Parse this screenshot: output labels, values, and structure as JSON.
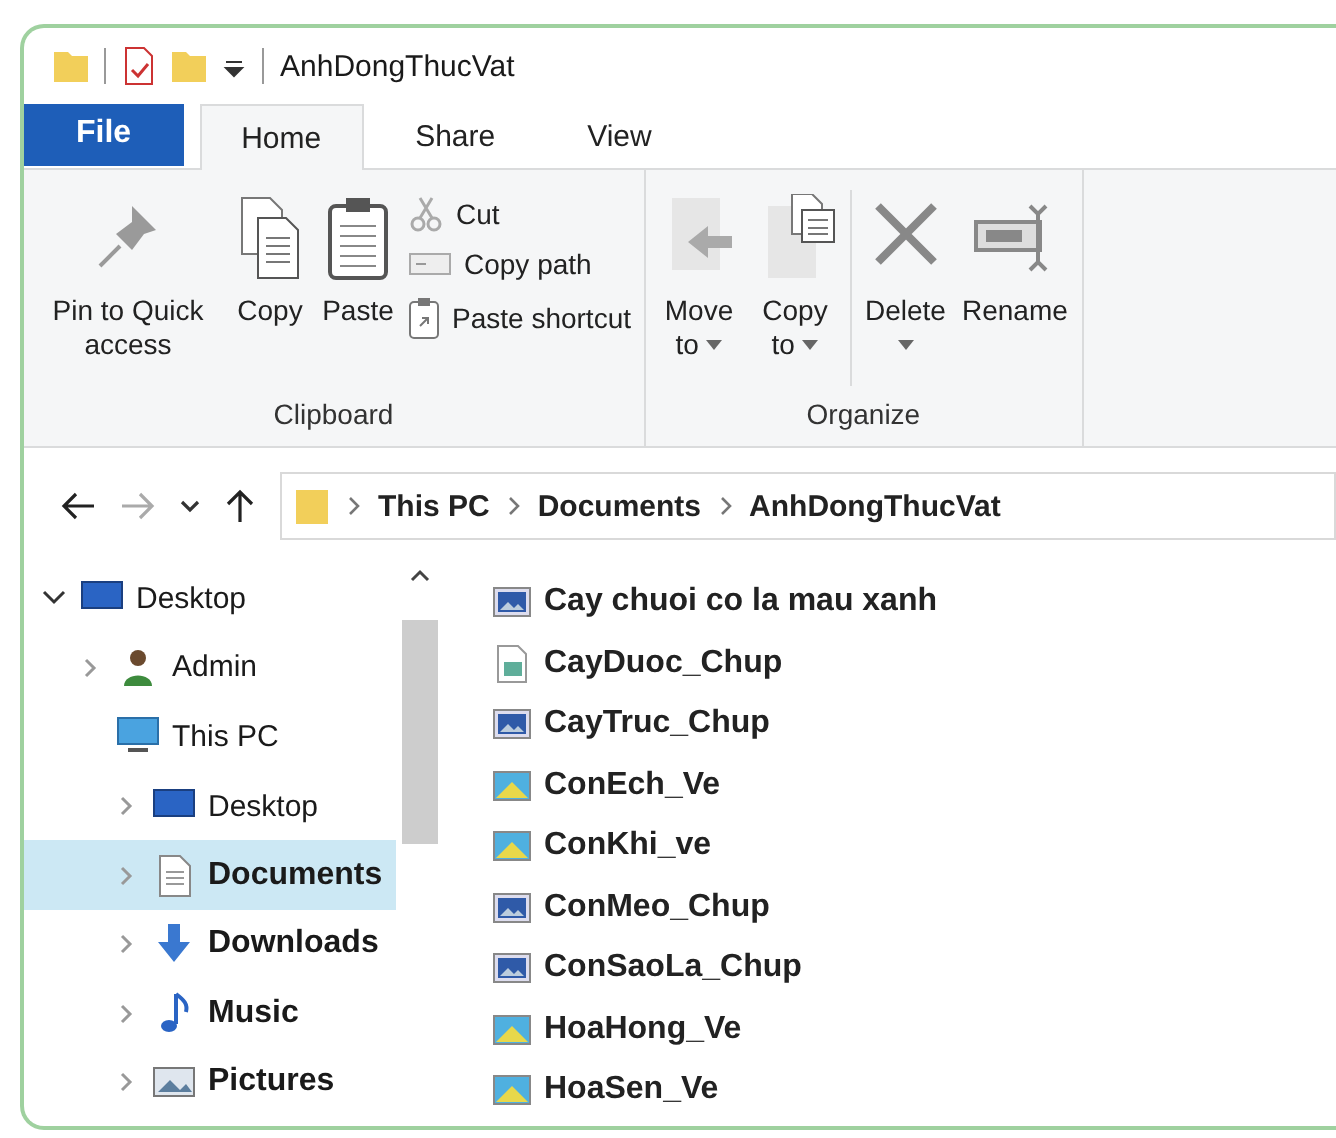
{
  "window": {
    "title": "AnhDongThucVat"
  },
  "ribbon_tabs": [
    {
      "label": "File",
      "kind": "file",
      "selected": false
    },
    {
      "label": "Home",
      "kind": "tab",
      "selected": true
    },
    {
      "label": "Share",
      "kind": "tab",
      "selected": false
    },
    {
      "label": "View",
      "kind": "tab",
      "selected": false
    }
  ],
  "ribbon_groups": [
    {
      "label": "Clipboard",
      "commands": [
        {
          "label": "Pin to Quick access",
          "kind": "large",
          "dropdown": false
        },
        {
          "label": "Copy",
          "kind": "large",
          "dropdown": false
        },
        {
          "label": "Paste",
          "kind": "large",
          "dropdown": false
        },
        {
          "kind": "stack",
          "items": [
            {
              "label": "Cut"
            },
            {
              "label": "Copy path"
            },
            {
              "label": "Paste shortcut"
            }
          ]
        }
      ]
    },
    {
      "label": "Organize",
      "commands": [
        {
          "label": "Move to",
          "kind": "large",
          "dropdown": true
        },
        {
          "label": "Copy to",
          "kind": "large",
          "dropdown": true
        },
        {
          "kind": "divider"
        },
        {
          "label": "Delete",
          "kind": "large",
          "dropdown": true
        },
        {
          "label": "Rename",
          "kind": "large",
          "dropdown": false
        }
      ]
    }
  ],
  "address_bar": {
    "crumbs": [
      "This PC",
      "Documents",
      "AnhDongThucVat"
    ]
  },
  "navigation_pane": {
    "items": [
      {
        "label": "Desktop",
        "kind": "desktop",
        "expanded": true,
        "selected": false,
        "bold": false,
        "children": [
          {
            "label": "Admin",
            "kind": "user",
            "expanded": false,
            "selected": false,
            "bold": false
          },
          {
            "label": "This PC",
            "kind": "pc",
            "selected": false,
            "bold": false,
            "children": [
              {
                "label": "Desktop",
                "kind": "desktop",
                "expanded": false,
                "selected": false,
                "bold": false
              },
              {
                "label": "Documents",
                "kind": "documents",
                "expanded": false,
                "selected": true,
                "bold": true
              },
              {
                "label": "Downloads",
                "kind": "downloads",
                "expanded": false,
                "selected": false,
                "bold": true
              },
              {
                "label": "Music",
                "kind": "music",
                "expanded": false,
                "selected": false,
                "bold": true
              },
              {
                "label": "Pictures",
                "kind": "pictures",
                "expanded": false,
                "selected": false,
                "bold": true
              }
            ]
          }
        ]
      }
    ]
  },
  "files": [
    {
      "name": "Cay chuoi co la mau xanh",
      "kind": "photo"
    },
    {
      "name": "CayDuoc_Chup",
      "kind": "image"
    },
    {
      "name": "CayTruc_Chup",
      "kind": "photo"
    },
    {
      "name": "ConEch_Ve",
      "kind": "drawing"
    },
    {
      "name": "ConKhi_ve",
      "kind": "drawing"
    },
    {
      "name": "ConMeo_Chup",
      "kind": "photo"
    },
    {
      "name": "ConSaoLa_Chup",
      "kind": "photo"
    },
    {
      "name": "HoaHong_Ve",
      "kind": "drawing"
    },
    {
      "name": "HoaSen_Ve",
      "kind": "drawing"
    }
  ]
}
